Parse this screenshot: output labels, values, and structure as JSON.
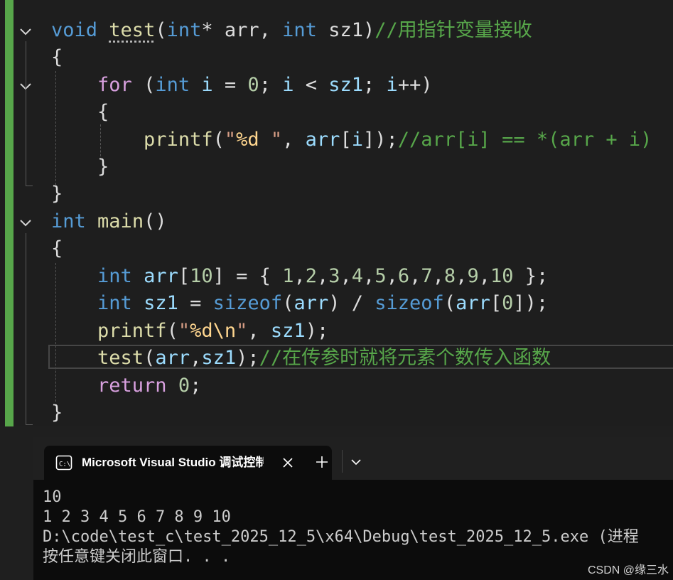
{
  "editor": {
    "lines": [
      {
        "id": "line-1",
        "tokens": [
          {
            "t": "void",
            "c": "kw"
          },
          {
            "t": " ",
            "c": "pl"
          },
          {
            "t": "test",
            "c": "fn fn-test"
          },
          {
            "t": "(",
            "c": "pl"
          },
          {
            "t": "int",
            "c": "kw"
          },
          {
            "t": "* arr, ",
            "c": "pl"
          },
          {
            "t": "int",
            "c": "kw"
          },
          {
            "t": " sz1)",
            "c": "pl"
          },
          {
            "t": "//用指针变量接收",
            "c": "cmt"
          }
        ]
      },
      {
        "id": "line-2",
        "tokens": [
          {
            "t": "{",
            "c": "pl"
          }
        ]
      },
      {
        "id": "line-3",
        "tokens": [
          {
            "t": "    ",
            "c": "pl"
          },
          {
            "t": "for",
            "c": "ctl"
          },
          {
            "t": " (",
            "c": "pl"
          },
          {
            "t": "int",
            "c": "kw"
          },
          {
            "t": " ",
            "c": "pl"
          },
          {
            "t": "i",
            "c": "var"
          },
          {
            "t": " = ",
            "c": "pl"
          },
          {
            "t": "0",
            "c": "num"
          },
          {
            "t": "; ",
            "c": "pl"
          },
          {
            "t": "i",
            "c": "var"
          },
          {
            "t": " < ",
            "c": "pl"
          },
          {
            "t": "sz1",
            "c": "var"
          },
          {
            "t": "; ",
            "c": "pl"
          },
          {
            "t": "i",
            "c": "var"
          },
          {
            "t": "++)",
            "c": "pl"
          }
        ]
      },
      {
        "id": "line-4",
        "tokens": [
          {
            "t": "    {",
            "c": "pl"
          }
        ]
      },
      {
        "id": "line-5",
        "tokens": [
          {
            "t": "        ",
            "c": "pl"
          },
          {
            "t": "printf",
            "c": "fn"
          },
          {
            "t": "(",
            "c": "pl"
          },
          {
            "t": "\"",
            "c": "str"
          },
          {
            "t": "%d",
            "c": "esc"
          },
          {
            "t": " \"",
            "c": "str"
          },
          {
            "t": ", ",
            "c": "pl"
          },
          {
            "t": "arr",
            "c": "var"
          },
          {
            "t": "[",
            "c": "pl"
          },
          {
            "t": "i",
            "c": "var"
          },
          {
            "t": "]);",
            "c": "pl"
          },
          {
            "t": "//arr[i] == *(arr + i)",
            "c": "cmt"
          }
        ]
      },
      {
        "id": "line-6",
        "tokens": [
          {
            "t": "    }",
            "c": "pl"
          }
        ]
      },
      {
        "id": "line-7",
        "tokens": [
          {
            "t": "}",
            "c": "pl"
          }
        ]
      },
      {
        "id": "line-8",
        "tokens": [
          {
            "t": "int",
            "c": "kw"
          },
          {
            "t": " ",
            "c": "pl"
          },
          {
            "t": "main",
            "c": "fn"
          },
          {
            "t": "()",
            "c": "pl"
          }
        ]
      },
      {
        "id": "line-9",
        "tokens": [
          {
            "t": "{",
            "c": "pl"
          }
        ]
      },
      {
        "id": "line-10",
        "tokens": [
          {
            "t": "    ",
            "c": "pl"
          },
          {
            "t": "int",
            "c": "kw"
          },
          {
            "t": " ",
            "c": "pl"
          },
          {
            "t": "arr",
            "c": "var"
          },
          {
            "t": "[",
            "c": "pl"
          },
          {
            "t": "10",
            "c": "num"
          },
          {
            "t": "] = { ",
            "c": "pl"
          },
          {
            "t": "1",
            "c": "num"
          },
          {
            "t": ",",
            "c": "pl"
          },
          {
            "t": "2",
            "c": "num"
          },
          {
            "t": ",",
            "c": "pl"
          },
          {
            "t": "3",
            "c": "num"
          },
          {
            "t": ",",
            "c": "pl"
          },
          {
            "t": "4",
            "c": "num"
          },
          {
            "t": ",",
            "c": "pl"
          },
          {
            "t": "5",
            "c": "num"
          },
          {
            "t": ",",
            "c": "pl"
          },
          {
            "t": "6",
            "c": "num"
          },
          {
            "t": ",",
            "c": "pl"
          },
          {
            "t": "7",
            "c": "num"
          },
          {
            "t": ",",
            "c": "pl"
          },
          {
            "t": "8",
            "c": "num"
          },
          {
            "t": ",",
            "c": "pl"
          },
          {
            "t": "9",
            "c": "num"
          },
          {
            "t": ",",
            "c": "pl"
          },
          {
            "t": "10",
            "c": "num"
          },
          {
            "t": " };",
            "c": "pl"
          }
        ]
      },
      {
        "id": "line-11",
        "tokens": [
          {
            "t": "    ",
            "c": "pl"
          },
          {
            "t": "int",
            "c": "kw"
          },
          {
            "t": " ",
            "c": "pl"
          },
          {
            "t": "sz1",
            "c": "var"
          },
          {
            "t": " = ",
            "c": "pl"
          },
          {
            "t": "sizeof",
            "c": "kw"
          },
          {
            "t": "(",
            "c": "pl"
          },
          {
            "t": "arr",
            "c": "var"
          },
          {
            "t": ") / ",
            "c": "pl"
          },
          {
            "t": "sizeof",
            "c": "kw"
          },
          {
            "t": "(",
            "c": "pl"
          },
          {
            "t": "arr",
            "c": "var"
          },
          {
            "t": "[",
            "c": "pl"
          },
          {
            "t": "0",
            "c": "num"
          },
          {
            "t": "]);",
            "c": "pl"
          }
        ]
      },
      {
        "id": "line-12",
        "tokens": [
          {
            "t": "    ",
            "c": "pl"
          },
          {
            "t": "printf",
            "c": "fn"
          },
          {
            "t": "(",
            "c": "pl"
          },
          {
            "t": "\"",
            "c": "str"
          },
          {
            "t": "%d\\n",
            "c": "esc"
          },
          {
            "t": "\"",
            "c": "str"
          },
          {
            "t": ", ",
            "c": "pl"
          },
          {
            "t": "sz1",
            "c": "var"
          },
          {
            "t": ");",
            "c": "pl"
          }
        ]
      },
      {
        "id": "line-13",
        "tokens": [
          {
            "t": "    ",
            "c": "pl"
          },
          {
            "t": "test",
            "c": "fn"
          },
          {
            "t": "(",
            "c": "pl"
          },
          {
            "t": "arr",
            "c": "var"
          },
          {
            "t": ",",
            "c": "pl"
          },
          {
            "t": "sz1",
            "c": "var"
          },
          {
            "t": ");",
            "c": "pl"
          },
          {
            "t": "//在传参时就将元素个数传入函数",
            "c": "cmt"
          }
        ]
      },
      {
        "id": "line-14",
        "tokens": [
          {
            "t": "    ",
            "c": "pl"
          },
          {
            "t": "return",
            "c": "ctl"
          },
          {
            "t": " ",
            "c": "pl"
          },
          {
            "t": "0",
            "c": "num"
          },
          {
            "t": ";",
            "c": "pl"
          }
        ]
      },
      {
        "id": "line-15",
        "tokens": [
          {
            "t": "}",
            "c": "pl"
          }
        ]
      }
    ]
  },
  "terminal": {
    "tab_title": "Microsoft Visual Studio 调试控制台",
    "new_tab_label": "+",
    "output": [
      "10",
      "1 2 3 4 5 6 7 8 9 10",
      "D:\\code\\test_c\\test_2025_12_5\\x64\\Debug\\test_2025_12_5.exe (进程",
      "按任意键关闭此窗口. . ."
    ]
  },
  "watermark": "CSDN @缘三水",
  "colors": {
    "keyword": "#569cd6",
    "control": "#d8a0df",
    "function": "#dcdcaa",
    "variable": "#9cdcfe",
    "number": "#b5cea8",
    "string": "#d69d85",
    "escape": "#ffd68f",
    "comment": "#57a64a"
  },
  "icons": [
    "chevron-down-icon",
    "console-icon",
    "close-icon",
    "plus-icon"
  ]
}
